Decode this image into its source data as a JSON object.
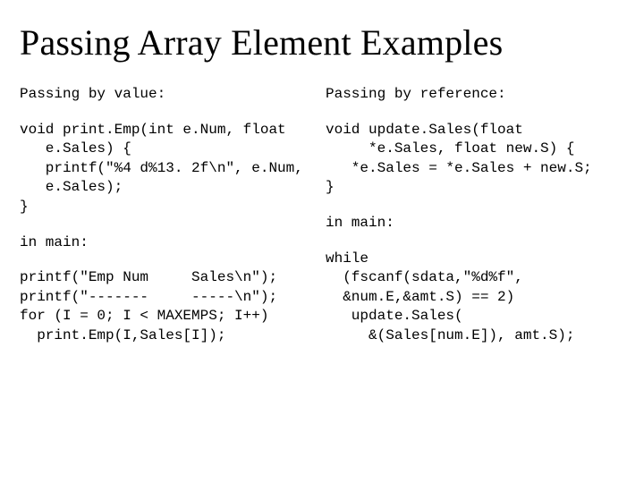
{
  "title": "Passing Array Element Examples",
  "left": {
    "heading": "Passing by value:",
    "func": "void print.Emp(int e.Num, float\n   e.Sales) {\n   printf(\"%4 d%13. 2f\\n\", e.Num,\n   e.Sales);\n}",
    "main_label": "in main:",
    "main_code": "printf(\"Emp Num     Sales\\n\");\nprintf(\"-------     -----\\n\");\nfor (I = 0; I < MAXEMPS; I++)\n  print.Emp(I,Sales[I]);"
  },
  "right": {
    "heading": "Passing by reference:",
    "func": "void update.Sales(float\n     *e.Sales, float new.S) {\n   *e.Sales = *e.Sales + new.S;\n}",
    "main_label": "in main:",
    "main_code": "while\n  (fscanf(sdata,\"%d%f\",\n  &num.E,&amt.S) == 2)\n   update.Sales(\n     &(Sales[num.E]), amt.S);"
  }
}
